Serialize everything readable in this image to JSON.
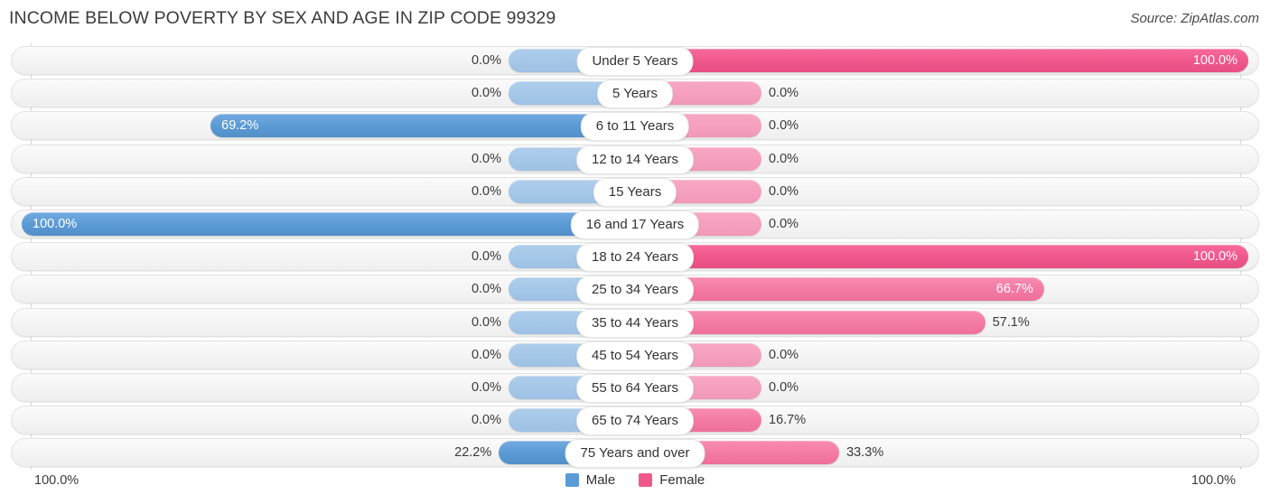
{
  "header": {
    "title": "INCOME BELOW POVERTY BY SEX AND AGE IN ZIP CODE 99329",
    "source": "Source: ZipAtlas.com"
  },
  "footer": {
    "axis_left": "100.0%",
    "axis_right": "100.0%",
    "legend": [
      {
        "label": "Male",
        "color": "#5b9bd5"
      },
      {
        "label": "Female",
        "color": "#f0588c"
      }
    ]
  },
  "colors": {
    "male": "#5b9bd5",
    "male_zero": "#a6c8e8",
    "female": "#f0588c",
    "female_mid": "#f47ba4",
    "female_zero": "#f5a0be",
    "track": "#f4f4f4",
    "gridline": "#d8d8d8"
  },
  "chart_data": {
    "type": "bar",
    "subtype": "diverging-bidirectional",
    "title": "INCOME BELOW POVERTY BY SEX AND AGE IN ZIP CODE 99329",
    "xlabel": "",
    "ylabel": "",
    "xlim": [
      0,
      100
    ],
    "unit": "%",
    "grid": true,
    "legend_position": "bottom-center",
    "axis_ticks": [
      "100.0%",
      "100.0%"
    ],
    "categories": [
      "Under 5 Years",
      "5 Years",
      "6 to 11 Years",
      "12 to 14 Years",
      "15 Years",
      "16 and 17 Years",
      "18 to 24 Years",
      "25 to 34 Years",
      "35 to 44 Years",
      "45 to 54 Years",
      "55 to 64 Years",
      "65 to 74 Years",
      "75 Years and over"
    ],
    "series": [
      {
        "name": "Male",
        "direction": "left",
        "values": [
          0.0,
          0.0,
          69.2,
          0.0,
          0.0,
          100.0,
          0.0,
          0.0,
          0.0,
          0.0,
          0.0,
          0.0,
          22.2
        ],
        "labels": [
          "0.0%",
          "0.0%",
          "69.2%",
          "0.0%",
          "0.0%",
          "100.0%",
          "0.0%",
          "0.0%",
          "0.0%",
          "0.0%",
          "0.0%",
          "0.0%",
          "22.2%"
        ]
      },
      {
        "name": "Female",
        "direction": "right",
        "values": [
          100.0,
          0.0,
          0.0,
          0.0,
          0.0,
          0.0,
          100.0,
          66.7,
          57.1,
          0.0,
          0.0,
          16.7,
          33.3
        ],
        "labels": [
          "100.0%",
          "0.0%",
          "0.0%",
          "0.0%",
          "0.0%",
          "0.0%",
          "100.0%",
          "66.7%",
          "57.1%",
          "0.0%",
          "0.0%",
          "16.7%",
          "33.3%"
        ]
      }
    ]
  }
}
